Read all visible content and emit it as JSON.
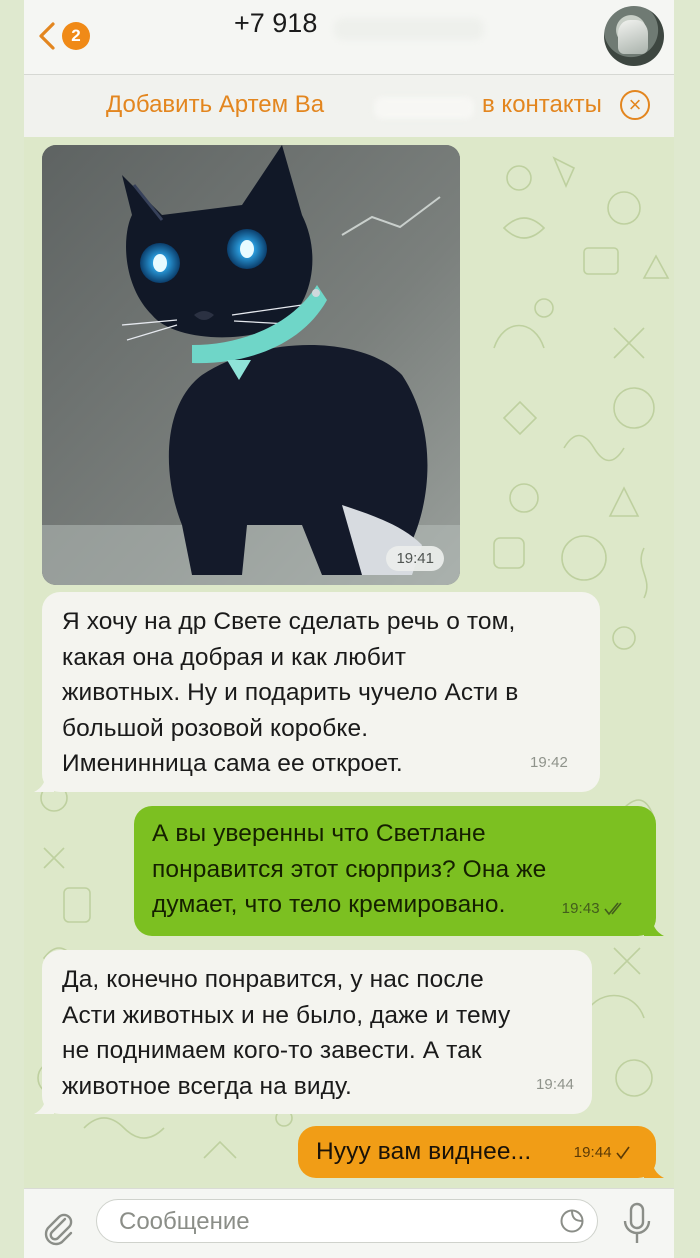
{
  "header": {
    "back_badge": "2",
    "title": "+7 918"
  },
  "add_contact": {
    "text_left": "Добавить Артем Ва",
    "text_right": "в контакты"
  },
  "messages": [
    {
      "type": "photo",
      "direction": "in",
      "time": "19:41"
    },
    {
      "type": "text",
      "direction": "in",
      "text": "Я хочу на др Свете сделать речь о том,\nкакая она добрая и как любит\nживотных. Ну и подарить чучело Асти в\nбольшой розовой коробке.\nИменинница сама ее откроет.",
      "time": "19:42"
    },
    {
      "type": "text",
      "direction": "out",
      "text": "А вы уверенны что Светлане\nпонравится этот сюрприз? Она же\nдумает, что тело кремировано.",
      "time": "19:43",
      "status": "read"
    },
    {
      "type": "text",
      "direction": "in",
      "text": "Да, конечно понравится, у нас после\nАсти животных и не было, даже и тему\nне поднимаем кого-то завести. А так\nживотное всегда на виду.",
      "time": "19:44"
    },
    {
      "type": "text",
      "direction": "out",
      "text": "Нууу вам виднее...",
      "time": "19:44",
      "status": "sent"
    }
  ],
  "input": {
    "placeholder": "Сообщение"
  },
  "colors": {
    "accent": "#e3861f",
    "outgoing_bubble": "#7cc021",
    "outgoing_bubble_last": "#f19d16",
    "incoming_bubble": "#f4f4ef",
    "chat_background": "#dde8c9"
  },
  "icons": [
    "back-chevron-icon",
    "close-circle-icon",
    "paperclip-icon",
    "sticker-icon",
    "microphone-icon",
    "double-check-icon",
    "single-check-icon"
  ]
}
